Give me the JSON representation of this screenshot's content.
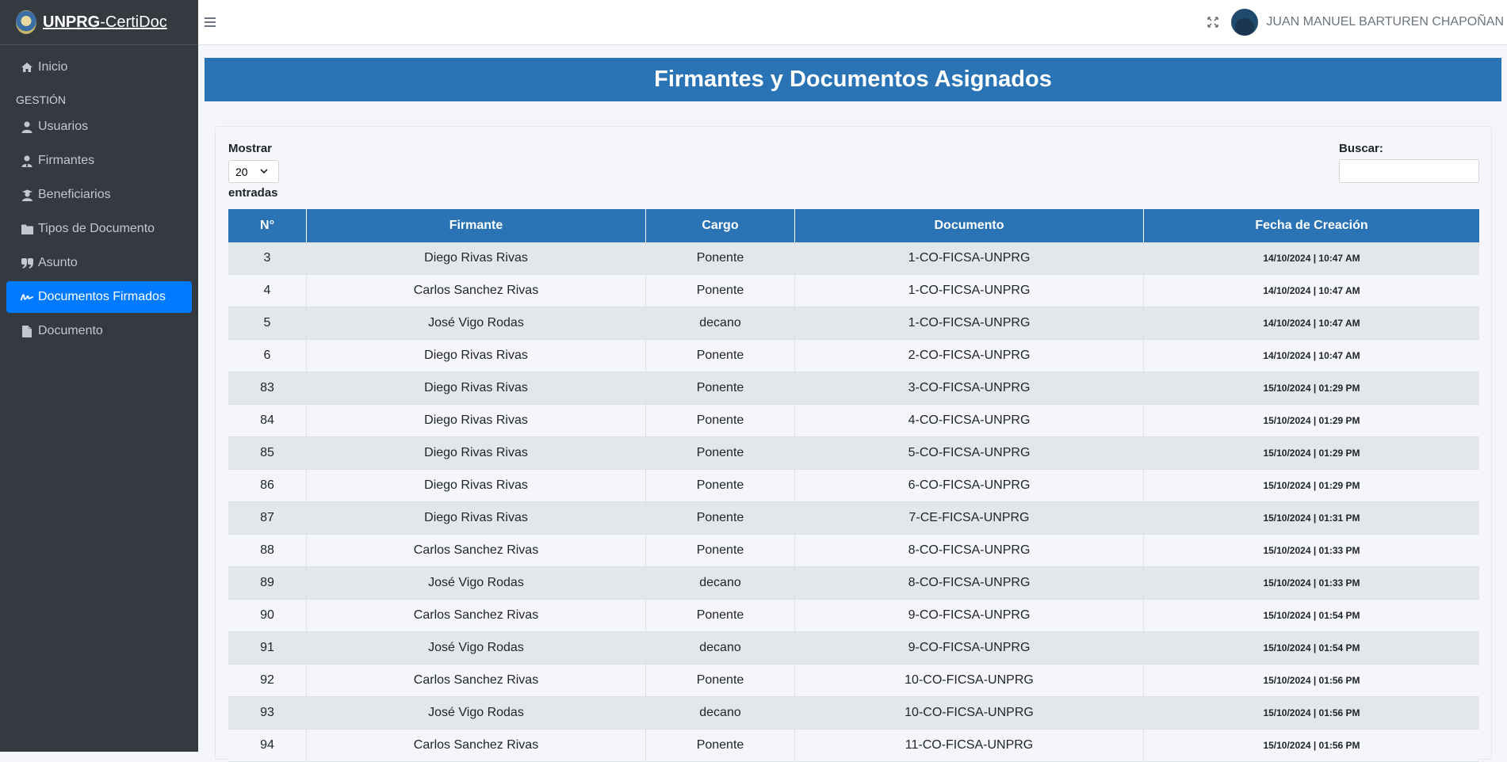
{
  "brand": {
    "bold": "UNPRG",
    "rest": "-CertiDoc"
  },
  "sidebar": {
    "items_top": [
      {
        "label": "Inicio",
        "icon": "home-icon"
      }
    ],
    "section_header": "GESTIÓN",
    "items": [
      {
        "label": "Usuarios",
        "icon": "user-icon"
      },
      {
        "label": "Firmantes",
        "icon": "user-tie-icon"
      },
      {
        "label": "Beneficiarios",
        "icon": "graduate-icon"
      },
      {
        "label": "Tipos de Documento",
        "icon": "folder-icon"
      },
      {
        "label": "Asunto",
        "icon": "quote-icon"
      },
      {
        "label": "Documentos Firmados",
        "icon": "signature-icon",
        "active": true
      },
      {
        "label": "Documento",
        "icon": "file-icon"
      }
    ]
  },
  "topbar": {
    "user_name": "JUAN MANUEL BARTUREN CHAPOÑAN"
  },
  "page": {
    "title": "Firmantes y Documentos Asignados"
  },
  "table_controls": {
    "show_label": "Mostrar",
    "page_length": "20",
    "entries_label": "entradas",
    "search_label": "Buscar:"
  },
  "table": {
    "headers": [
      "N°",
      "Firmante",
      "Cargo",
      "Documento",
      "Fecha de Creación"
    ],
    "rows": [
      [
        "3",
        "Diego Rivas Rivas",
        "Ponente",
        "1-CO-FICSA-UNPRG",
        "14/10/2024 | 10:47 AM"
      ],
      [
        "4",
        "Carlos Sanchez Rivas",
        "Ponente",
        "1-CO-FICSA-UNPRG",
        "14/10/2024 | 10:47 AM"
      ],
      [
        "5",
        "José Vigo Rodas",
        "decano",
        "1-CO-FICSA-UNPRG",
        "14/10/2024 | 10:47 AM"
      ],
      [
        "6",
        "Diego Rivas Rivas",
        "Ponente",
        "2-CO-FICSA-UNPRG",
        "14/10/2024 | 10:47 AM"
      ],
      [
        "83",
        "Diego Rivas Rivas",
        "Ponente",
        "3-CO-FICSA-UNPRG",
        "15/10/2024 | 01:29 PM"
      ],
      [
        "84",
        "Diego Rivas Rivas",
        "Ponente",
        "4-CO-FICSA-UNPRG",
        "15/10/2024 | 01:29 PM"
      ],
      [
        "85",
        "Diego Rivas Rivas",
        "Ponente",
        "5-CO-FICSA-UNPRG",
        "15/10/2024 | 01:29 PM"
      ],
      [
        "86",
        "Diego Rivas Rivas",
        "Ponente",
        "6-CO-FICSA-UNPRG",
        "15/10/2024 | 01:29 PM"
      ],
      [
        "87",
        "Diego Rivas Rivas",
        "Ponente",
        "7-CE-FICSA-UNPRG",
        "15/10/2024 | 01:31 PM"
      ],
      [
        "88",
        "Carlos Sanchez Rivas",
        "Ponente",
        "8-CO-FICSA-UNPRG",
        "15/10/2024 | 01:33 PM"
      ],
      [
        "89",
        "José Vigo Rodas",
        "decano",
        "8-CO-FICSA-UNPRG",
        "15/10/2024 | 01:33 PM"
      ],
      [
        "90",
        "Carlos Sanchez Rivas",
        "Ponente",
        "9-CO-FICSA-UNPRG",
        "15/10/2024 | 01:54 PM"
      ],
      [
        "91",
        "José Vigo Rodas",
        "decano",
        "9-CO-FICSA-UNPRG",
        "15/10/2024 | 01:54 PM"
      ],
      [
        "92",
        "Carlos Sanchez Rivas",
        "Ponente",
        "10-CO-FICSA-UNPRG",
        "15/10/2024 | 01:56 PM"
      ],
      [
        "93",
        "José Vigo Rodas",
        "decano",
        "10-CO-FICSA-UNPRG",
        "15/10/2024 | 01:56 PM"
      ],
      [
        "94",
        "Carlos Sanchez Rivas",
        "Ponente",
        "11-CO-FICSA-UNPRG",
        "15/10/2024 | 01:56 PM"
      ]
    ]
  },
  "colors": {
    "sidebar_bg": "#343a40",
    "accent": "#2a74b5",
    "active_nav": "#007bff"
  }
}
